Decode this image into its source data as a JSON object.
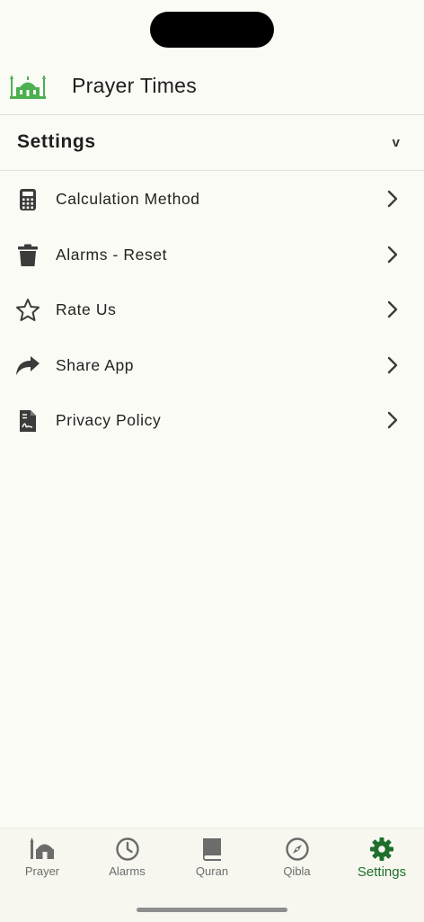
{
  "header": {
    "title": "Prayer Times",
    "logo_icon": "mosque-icon"
  },
  "section": {
    "title": "Settings",
    "toggle": "v"
  },
  "menu": {
    "items": [
      {
        "label": "Calculation Method",
        "icon": "calculator-icon"
      },
      {
        "label": "Alarms - Reset",
        "icon": "trash-icon"
      },
      {
        "label": "Rate Us",
        "icon": "star-icon"
      },
      {
        "label": "Share App",
        "icon": "share-icon"
      },
      {
        "label": "Privacy Policy",
        "icon": "document-icon"
      }
    ]
  },
  "tabs": [
    {
      "label": "Prayer",
      "icon": "mosque-icon",
      "active": false
    },
    {
      "label": "Alarms",
      "icon": "clock-icon",
      "active": false
    },
    {
      "label": "Quran",
      "icon": "book-icon",
      "active": false
    },
    {
      "label": "Qibla",
      "icon": "compass-icon",
      "active": false
    },
    {
      "label": "Settings",
      "icon": "gear-icon",
      "active": true
    }
  ],
  "colors": {
    "accent": "#1e6f2c",
    "background": "#fbfbf5",
    "icon": "#3b3b3b",
    "inactive_tab": "#6c6c6c"
  }
}
